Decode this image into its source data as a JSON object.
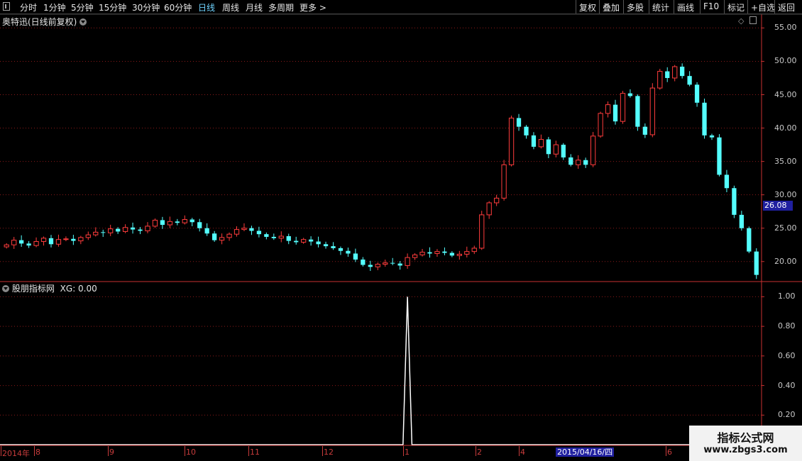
{
  "toolbar": {
    "left_items": [
      {
        "label": "分时",
        "active": false
      },
      {
        "label": "1分钟",
        "active": false
      },
      {
        "label": "5分钟",
        "active": false
      },
      {
        "label": "15分钟",
        "active": false
      },
      {
        "label": "30分钟",
        "active": false
      },
      {
        "label": "60分钟",
        "active": false
      },
      {
        "label": "日线",
        "active": true
      },
      {
        "label": "周线",
        "active": false
      },
      {
        "label": "月线",
        "active": false
      },
      {
        "label": "多周期",
        "active": false
      },
      {
        "label": "更多 >",
        "active": false
      }
    ],
    "right_items": [
      "复权",
      "叠加",
      "多股",
      "统计",
      "画线",
      "F10",
      "标记",
      "+自选",
      "返回"
    ]
  },
  "price_panel": {
    "title": "奥特迅(日线前复权)",
    "current_price_tag": "26.08",
    "y_ticks": [
      "55.00",
      "50.00",
      "45.00",
      "40.00",
      "35.00",
      "30.00",
      "25.00",
      "20.00"
    ]
  },
  "indicator_panel": {
    "title": "股朋指标网",
    "xg_label": "XG: 0.00",
    "y_ticks": [
      "1.00",
      "0.80",
      "0.60",
      "0.40",
      "0.20"
    ]
  },
  "date_axis": {
    "labels": [
      "2014年",
      "8",
      "9",
      "10",
      "11",
      "12",
      "1",
      "2",
      "4",
      "6"
    ],
    "cursor_date": "2015/04/16/四"
  },
  "watermark": {
    "line1": "指标公式网",
    "line2": "www.zbgs3.com"
  },
  "colors": {
    "up": "#ff3c3c",
    "down": "#54ffff",
    "grid": "#8b1a1a",
    "axis": "#c83030",
    "indicator_line": "#ffffff",
    "highlight": "#2020a0"
  },
  "chart_data": [
    {
      "type": "candlestick",
      "title": "奥特迅(日线前复权)",
      "ylim": [
        17,
        56
      ],
      "y_ticks": [
        20,
        25,
        30,
        35,
        40,
        45,
        50,
        55
      ],
      "x_labels": [
        "2014年",
        "8",
        "9",
        "10",
        "11",
        "12",
        "1",
        "2",
        "4",
        "6"
      ],
      "last_price": 26.08,
      "closes": [
        22.5,
        23.2,
        22.7,
        22.4,
        23.0,
        23.5,
        22.6,
        23.3,
        23.4,
        23.1,
        23.6,
        24.0,
        24.4,
        24.3,
        24.9,
        24.5,
        25.1,
        24.8,
        24.6,
        25.3,
        26.2,
        25.5,
        26.0,
        25.8,
        26.3,
        25.9,
        25.0,
        24.2,
        23.2,
        23.6,
        24.1,
        24.8,
        25.0,
        24.6,
        24.1,
        23.7,
        23.5,
        23.8,
        23.1,
        22.9,
        23.3,
        23.0,
        22.6,
        22.3,
        22.0,
        21.6,
        21.2,
        20.3,
        19.5,
        19.2,
        19.6,
        19.8,
        19.7,
        19.4,
        20.6,
        21.0,
        21.4,
        21.2,
        21.5,
        21.3,
        20.9,
        21.1,
        21.5,
        22.0,
        27.0,
        28.8,
        29.5,
        34.5,
        41.5,
        40.2,
        38.9,
        37.2,
        38.3,
        36.1,
        37.5,
        35.6,
        34.5,
        35.2,
        34.5,
        38.8,
        42.2,
        43.5,
        41.0,
        45.2,
        44.8,
        40.2,
        39.0,
        46.0,
        48.5,
        47.5,
        49.2,
        47.8,
        46.5,
        43.8,
        38.9,
        38.6,
        33.0,
        31.0,
        27.0,
        25.0,
        21.5,
        18.0
      ]
    },
    {
      "type": "line",
      "title": "股朋指标网",
      "series": [
        {
          "name": "XG",
          "signal_index": 54,
          "signal_value": 1.0,
          "baseline": 0.0
        }
      ],
      "ylim": [
        0,
        1.05
      ],
      "y_ticks": [
        0.2,
        0.4,
        0.6,
        0.8,
        1.0
      ],
      "current_value": 0.0
    }
  ]
}
